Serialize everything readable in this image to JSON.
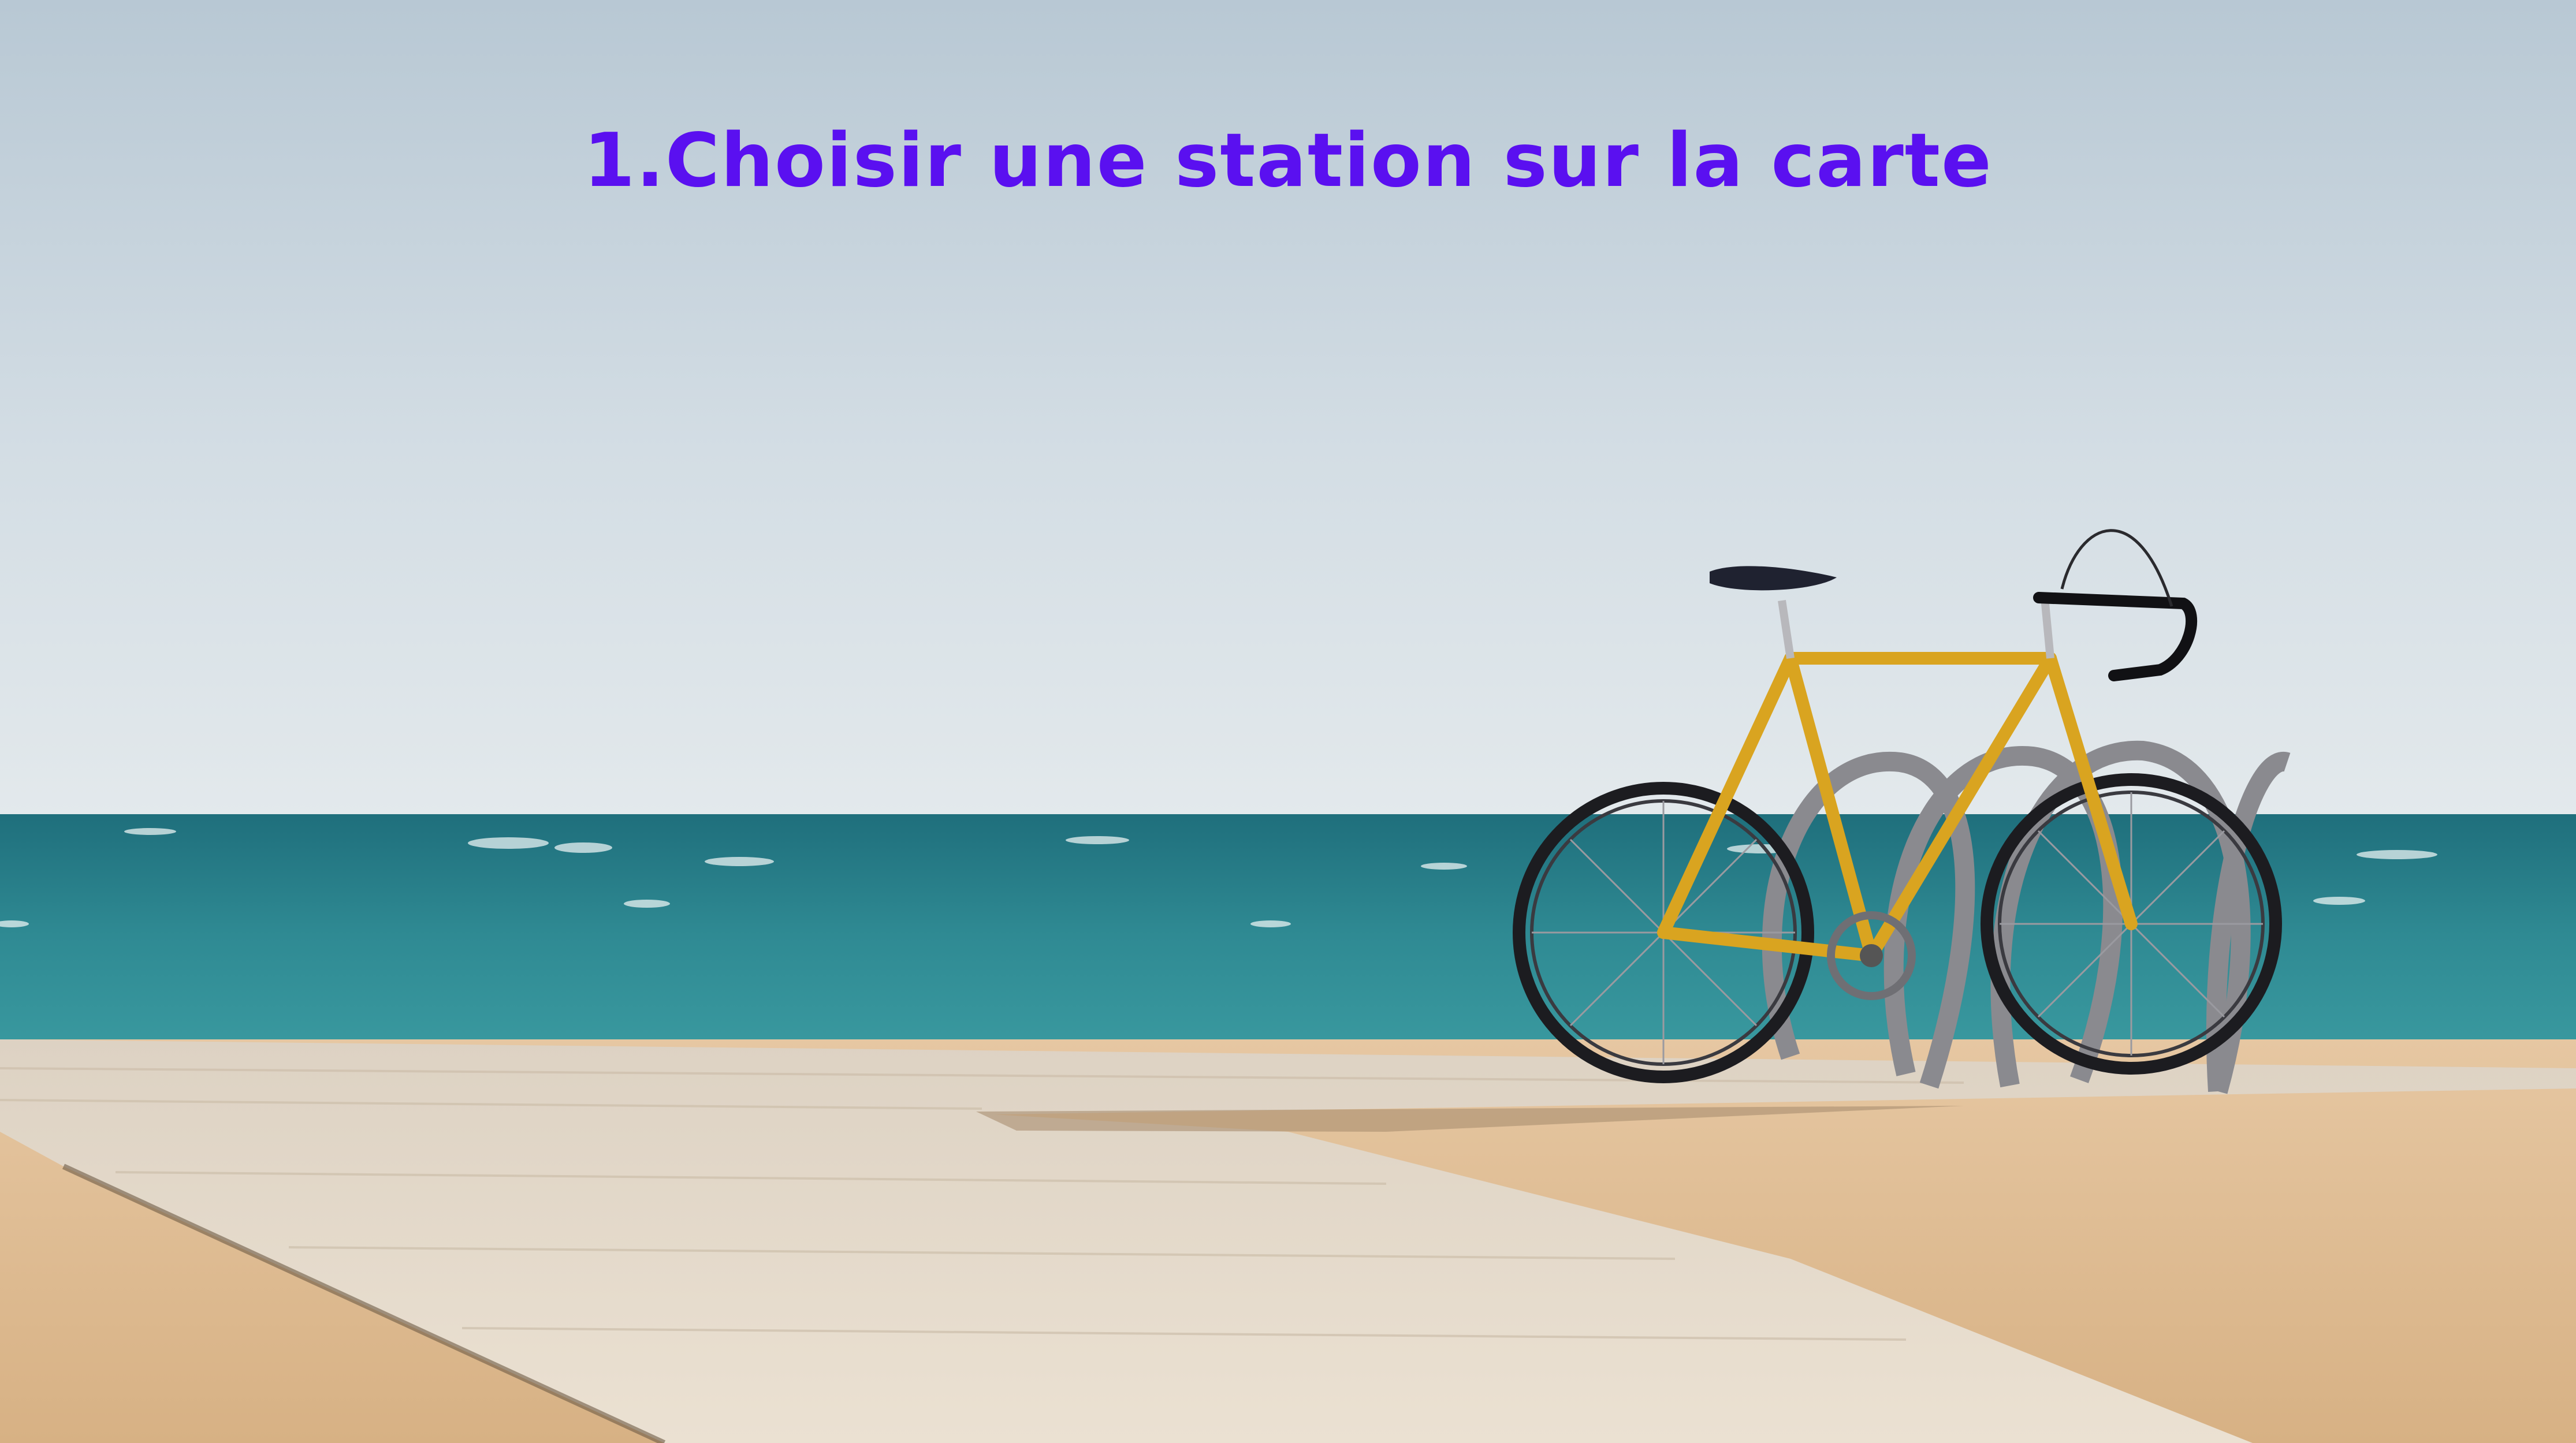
{
  "slide": {
    "heading": "1.Choisir une station sur la carte",
    "heading_color": "#5a10f0"
  },
  "scene": {
    "description_icons": [
      "sky-backdrop",
      "sea",
      "boardwalk",
      "sand",
      "bicycle",
      "bike-rack"
    ],
    "colors": {
      "sky_top": "#b8c8d4",
      "sky_bottom": "#dce5ea",
      "sea": "#2f8a93",
      "boardwalk": "#e4d8c6",
      "sand": "#dfbe97",
      "bike_frame": "#d9a420"
    }
  }
}
